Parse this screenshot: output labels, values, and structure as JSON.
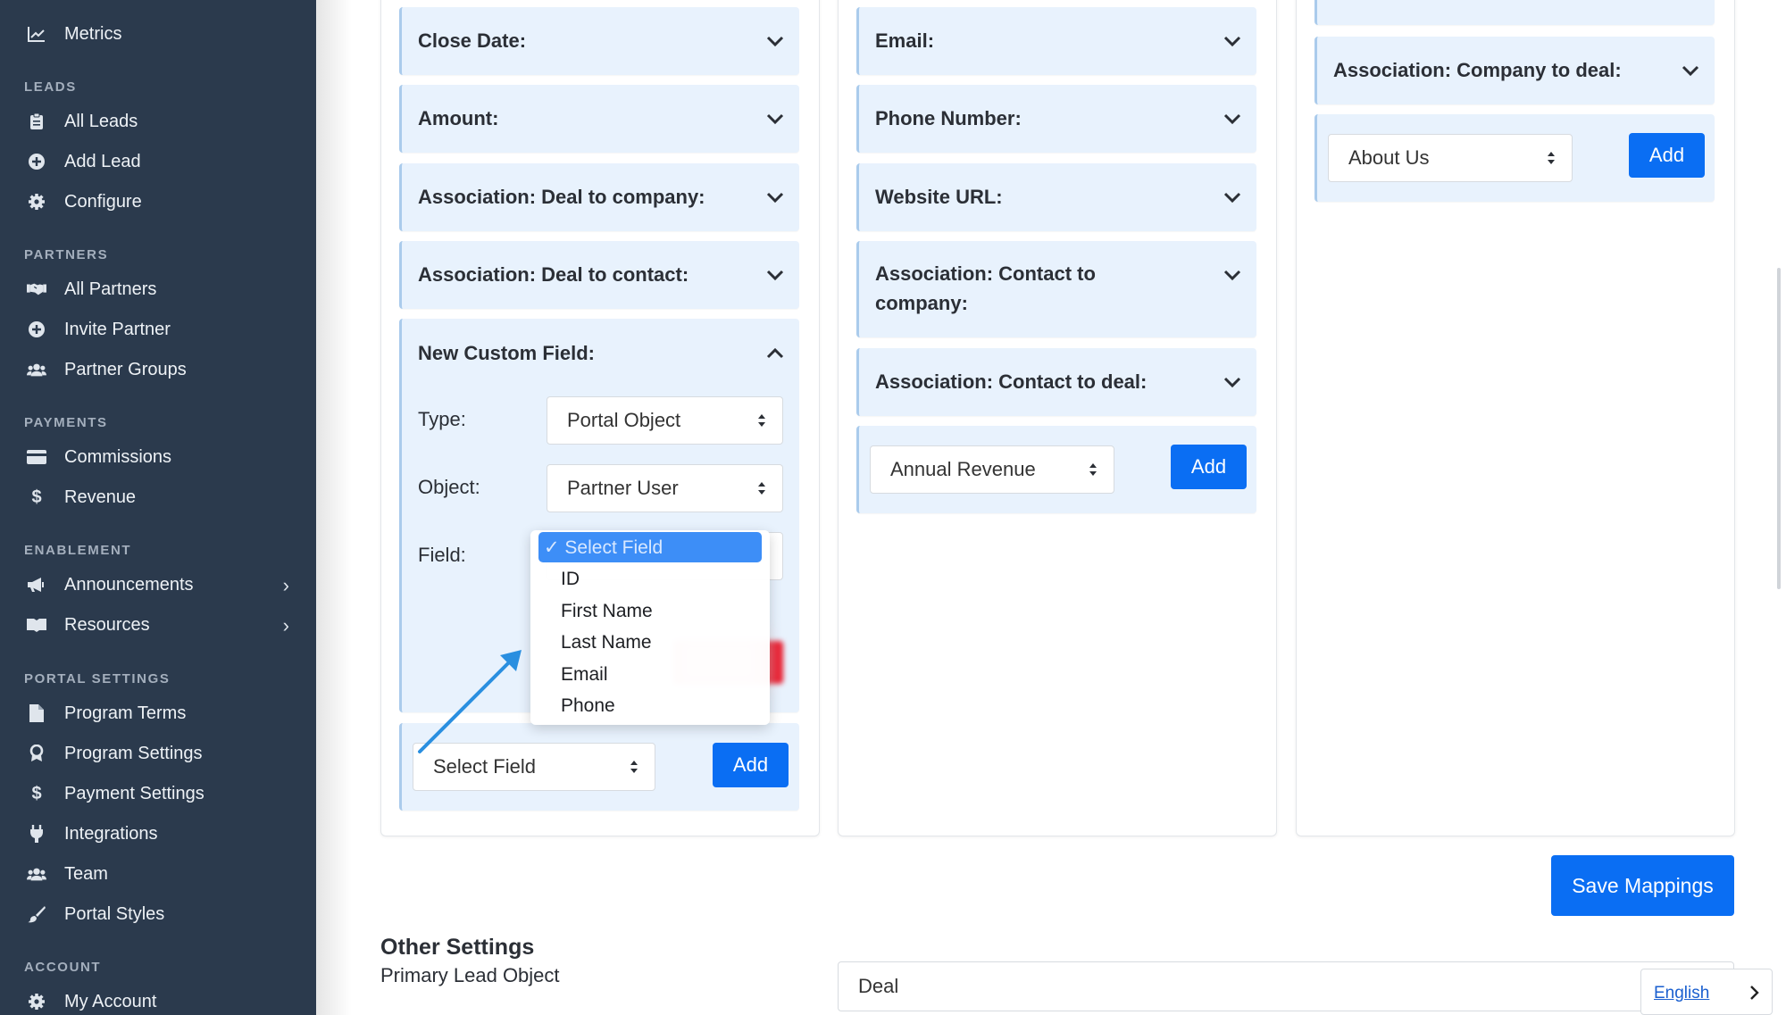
{
  "sidebar": {
    "top_item": "Metrics",
    "sections": {
      "leads": "LEADS",
      "partners": "PARTNERS",
      "payments": "PAYMENTS",
      "enablement": "ENABLEMENT",
      "portal_settings": "PORTAL SETTINGS",
      "account": "ACCOUNT"
    },
    "items": {
      "all_leads": "All Leads",
      "add_lead": "Add Lead",
      "configure": "Configure",
      "all_partners": "All Partners",
      "invite_partner": "Invite Partner",
      "partner_groups": "Partner Groups",
      "commissions": "Commissions",
      "revenue": "Revenue",
      "announcements": "Announcements",
      "resources": "Resources",
      "program_terms": "Program Terms",
      "program_settings": "Program Settings",
      "payment_settings": "Payment Settings",
      "integrations": "Integrations",
      "team": "Team",
      "portal_styles": "Portal Styles",
      "my_account": "My Account"
    }
  },
  "column1": {
    "close_date": "Close Date:",
    "amount": "Amount:",
    "assoc_deal_company": "Association: Deal to company:",
    "assoc_deal_contact": "Association: Deal to contact:",
    "new_custom_field": "New Custom Field:",
    "type_label": "Type:",
    "type_value": "Portal Object",
    "object_label": "Object:",
    "object_value": "Partner User",
    "field_label": "Field:",
    "add_select_value": "Select Field",
    "add_button": "Add"
  },
  "dropdown": {
    "selected": "✓ Select Field",
    "options": [
      "ID",
      "First Name",
      "Last Name",
      "Email",
      "Phone"
    ]
  },
  "column2": {
    "email": "Email:",
    "phone": "Phone Number:",
    "website": "Website URL:",
    "assoc_contact_company_1": "Association: Contact to",
    "assoc_contact_company_2": "company:",
    "assoc_contact_deal": "Association: Contact to deal:",
    "add_select_value": "Annual Revenue",
    "add_button": "Add"
  },
  "column3": {
    "assoc_company_deal": "Association: Company to deal:",
    "add_select_value": "About Us",
    "add_button": "Add"
  },
  "save_mappings": "Save Mappings",
  "other_settings": {
    "title": "Other Settings",
    "primary_lead_object_label": "Primary Lead Object",
    "primary_lead_object_value": "Deal"
  },
  "language": "English",
  "colors": {
    "sidebar_bg": "#2b3a4d",
    "accent": "#0a6ef3",
    "accordion_bg": "#e8f2fd"
  }
}
